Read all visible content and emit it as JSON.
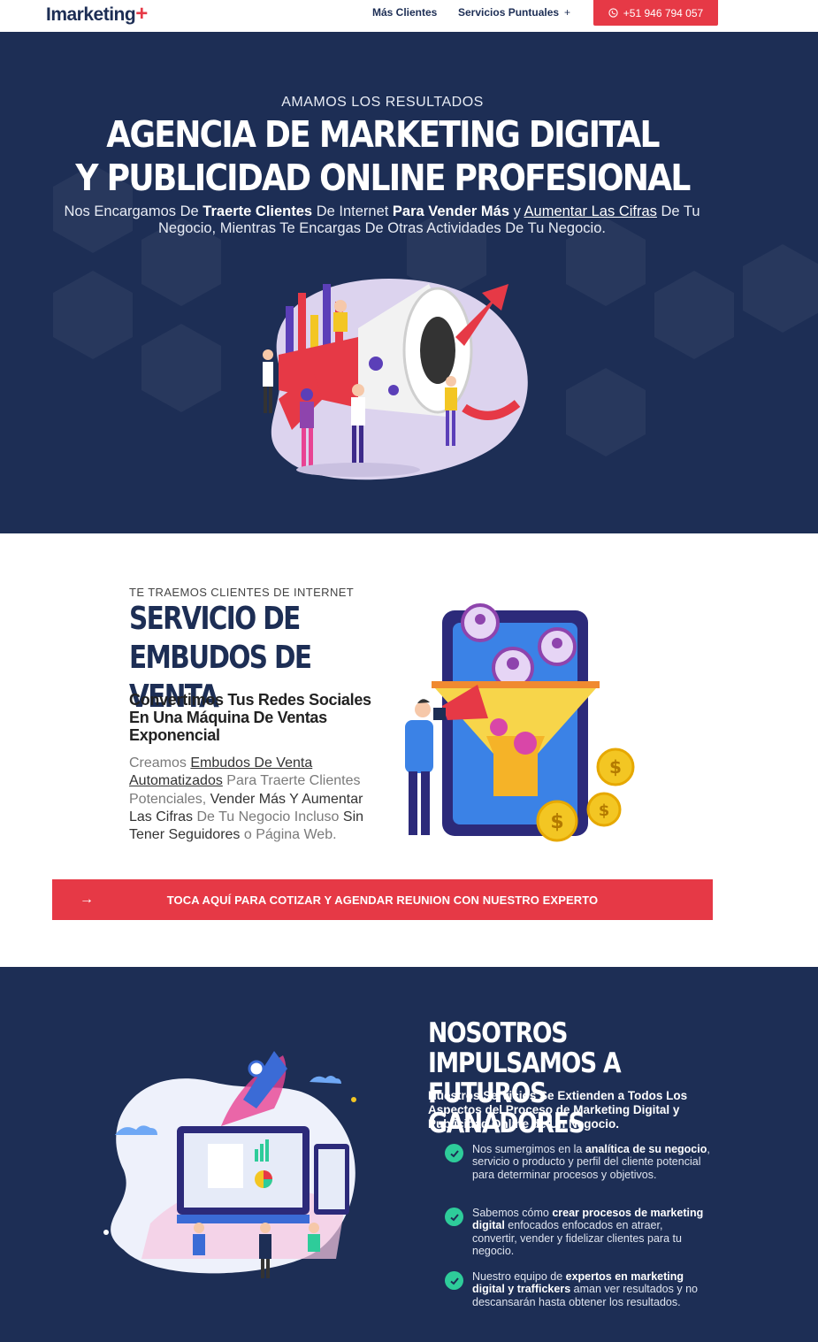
{
  "header": {
    "logo_text": "Imarketing",
    "logo_plus": "+",
    "nav": [
      {
        "label": "Más Clientes"
      },
      {
        "label": "Servicios Puntuales",
        "caret": "+"
      }
    ],
    "whatsapp_label": "+51 946 794 057"
  },
  "hero": {
    "eyebrow": "AMAMOS LOS RESULTADOS",
    "title_line1": "AGENCIA DE MARKETING DIGITAL",
    "title_line2": "Y PUBLICIDAD ONLINE PROFESIONAL",
    "sub_parts": [
      "Nos Encargamos De ",
      "Traerte Clientes",
      " De Internet ",
      "Para Vender Más",
      " y ",
      "Aumentar Las Cifras",
      " De Tu Negocio, Mientras Te Encargas De Otras Actividades De Tu Negocio."
    ]
  },
  "funnel_section": {
    "eyebrow": "TE TRAEMOS CLIENTES DE INTERNET",
    "title_line1": "SERVICIO DE",
    "title_line2": "EMBUDOS DE VENTA",
    "subtitle": "Convertimos Tus Redes Sociales En Una Máquina De Ventas Exponencial",
    "body_parts": [
      "Creamos ",
      "Embudos De Venta Automatizados",
      " Para Traerte Clientes Potenciales",
      ", ",
      "Vender Más Y Aumentar Las Cifras",
      " De Tu Negocio Incluso ",
      "Sin Tener Seguidores",
      " o ",
      "Página Web",
      "."
    ],
    "cta_arrow": "→",
    "cta_label": "TOCA AQUÍ PARA COTIZAR Y AGENDAR REUNION CON NUESTRO EXPERTO"
  },
  "impulse_section": {
    "title_line1": "NOSOTROS IMPULSAMOS A",
    "title_line2": "FUTUROS GANADORES",
    "lead": "Nuestros Servicios Se Extienden a Todos Los Aspectos del Proceso de Marketing Digital y Publicidad Online de Un Negocio.",
    "features": [
      {
        "pre": "Nos sumergimos en la ",
        "bold": "analítica de su negocio",
        "post": ", servicio o producto y perfil del cliente potencial para determinar procesos y objetivos."
      },
      {
        "pre": "Sabemos cómo ",
        "bold": "crear procesos de marketing digital",
        "post": " enfocados enfocados en atraer, convertir, vender y fidelizar clientes para tu negocio."
      },
      {
        "pre": "Nuestro equipo de ",
        "bold": "expertos en marketing digital y traffickers",
        "post": " aman ver resultados y no descansarán hasta obtener los resultados."
      }
    ]
  },
  "colors": {
    "navy": "#1d2e55",
    "accent_red": "#e63946",
    "check_green": "#2ecc9a"
  }
}
